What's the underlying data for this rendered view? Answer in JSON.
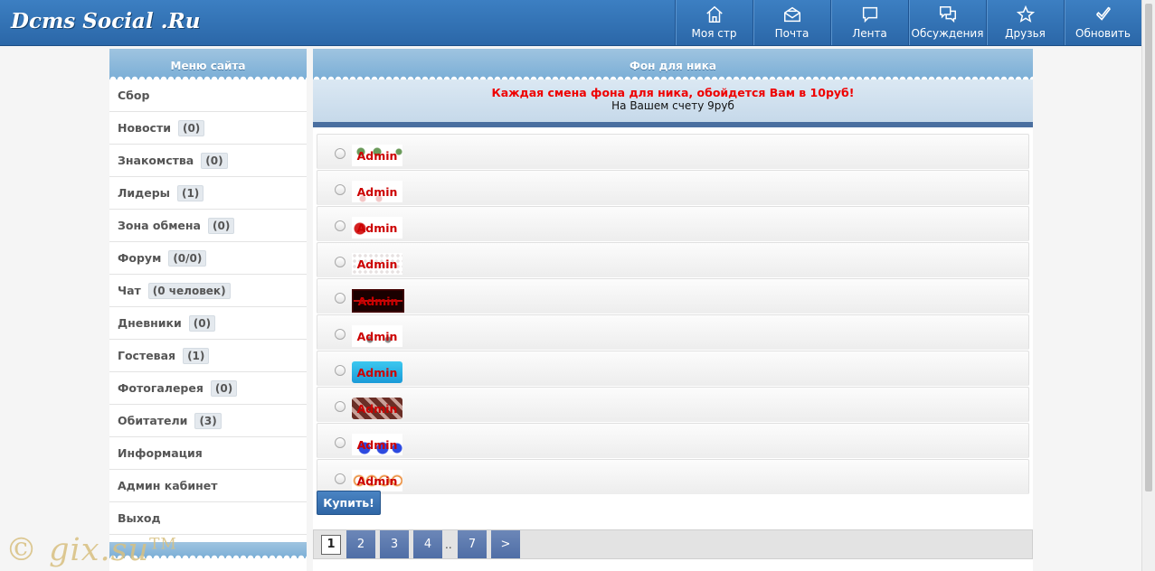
{
  "header": {
    "logo": "Dcms Social .Ru",
    "nav": [
      {
        "label": "Моя стр",
        "icon": "home-icon"
      },
      {
        "label": "Почта",
        "icon": "mail-icon"
      },
      {
        "label": "Лента",
        "icon": "feed-icon"
      },
      {
        "label": "Обсуждения",
        "icon": "discussions-icon"
      },
      {
        "label": "Друзья",
        "icon": "star-icon"
      },
      {
        "label": "Обновить",
        "icon": "checkmark-icon"
      }
    ]
  },
  "sidebar": {
    "title": "Меню сайта",
    "items": [
      {
        "label": "Сбор",
        "count": ""
      },
      {
        "label": "Новости",
        "count": "(0)"
      },
      {
        "label": "Знакомства",
        "count": "(0)"
      },
      {
        "label": "Лидеры",
        "count": "(1)"
      },
      {
        "label": "Зона обмена",
        "count": "(0)"
      },
      {
        "label": "Форум",
        "count": "(0/0)"
      },
      {
        "label": "Чат",
        "count": "(0 человек)"
      },
      {
        "label": "Дневники",
        "count": "(0)"
      },
      {
        "label": "Гостевая",
        "count": "(1)"
      },
      {
        "label": "Фотогалерея",
        "count": "(0)"
      },
      {
        "label": "Обитатели",
        "count": "(3)"
      },
      {
        "label": "Информация",
        "count": ""
      },
      {
        "label": "Админ кабинет",
        "count": ""
      },
      {
        "label": "Выход",
        "count": ""
      }
    ]
  },
  "main": {
    "title": "Фон для ника",
    "notice": "Каждая смена фона для ника, обойдется Вам в 10руб!",
    "balance": "На Вашем счету 9руб",
    "nick": "Admin",
    "backgrounds": [
      {
        "style": "flowers",
        "colors": [
          "#ffffff",
          "#6a9a5a"
        ]
      },
      {
        "style": "lace",
        "colors": [
          "#ffffff",
          "#f3c6c6"
        ]
      },
      {
        "style": "heart",
        "colors": [
          "#ffffff",
          "#d42020"
        ]
      },
      {
        "style": "dots",
        "colors": [
          "#ffffff",
          "#e6e0e0"
        ]
      },
      {
        "style": "pulse",
        "colors": [
          "#1a0000",
          "#c01010"
        ]
      },
      {
        "style": "figures",
        "colors": [
          "#ffffff",
          "#8a8a8a"
        ]
      },
      {
        "style": "cyan",
        "colors": [
          "#3cc8f0",
          "#1a9ad8"
        ]
      },
      {
        "style": "brown",
        "colors": [
          "#6a2e26",
          "#c8a098"
        ]
      },
      {
        "style": "blue-shapes",
        "colors": [
          "#ffffff",
          "#2d4ae0"
        ]
      },
      {
        "style": "rings",
        "colors": [
          "#ffffff",
          "#e67818"
        ]
      }
    ],
    "buy_label": "Купить!"
  },
  "pager": {
    "pages": [
      "1",
      "2",
      "3",
      "4",
      "7"
    ],
    "current": "1",
    "ellipsis": "..",
    "next": ">"
  },
  "watermark": {
    "text": "© gix.su",
    "tm": "TM"
  }
}
